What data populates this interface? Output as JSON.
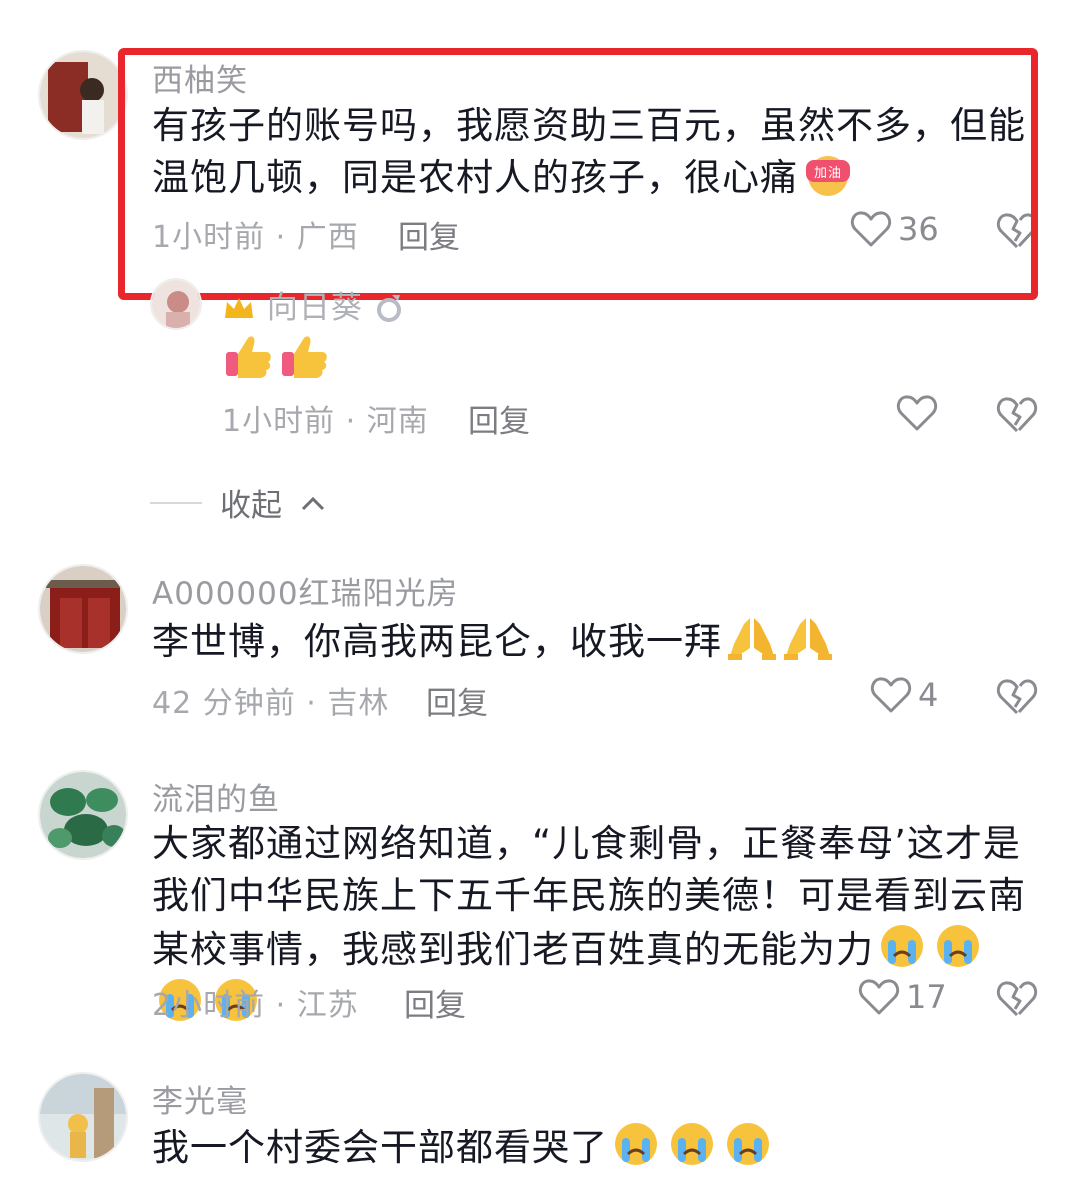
{
  "comments": [
    {
      "username": "西柚笑",
      "text": "有孩子的账号吗，我愿资助三百元，虽然不多，但能温饱几顿，同是农村人的孩子，很心痛",
      "emoji": "加油",
      "time_location": "1小时前 · 广西",
      "reply": "回复",
      "likes": "36"
    },
    {
      "username": "向日葵",
      "text": "",
      "time_location": "1小时前 · 河南",
      "reply": "回复",
      "likes": ""
    },
    {
      "username": "A000000红瑞阳光房",
      "text": "李世博，你高我两昆仑，收我一拜",
      "time_location": "42 分钟前 · 吉林",
      "reply": "回复",
      "likes": "4"
    },
    {
      "username": "流泪的鱼",
      "text": "大家都通过网络知道，“儿食剩骨，正餐奉母’这才是我们中华民族上下五千年民族的美德！可是看到云南某校事情，我感到我们老百姓真的无能为力",
      "time_location": "2小时前 · 江苏",
      "reply": "回复",
      "likes": "17"
    },
    {
      "username": "李光毫",
      "text": "我一个村委会干部都看哭了",
      "time_location": "",
      "reply": "",
      "likes": ""
    }
  ],
  "collapse_label": "收起",
  "colors": {
    "highlight": "#e8262b",
    "meta": "#a7a8ad"
  },
  "icons": [
    "heart-outline-icon",
    "broken-heart-icon",
    "thumbs-up-emoji",
    "pray-emoji",
    "crying-emoji",
    "cheer-badge-emoji",
    "crown-icon",
    "ring-icon"
  ]
}
